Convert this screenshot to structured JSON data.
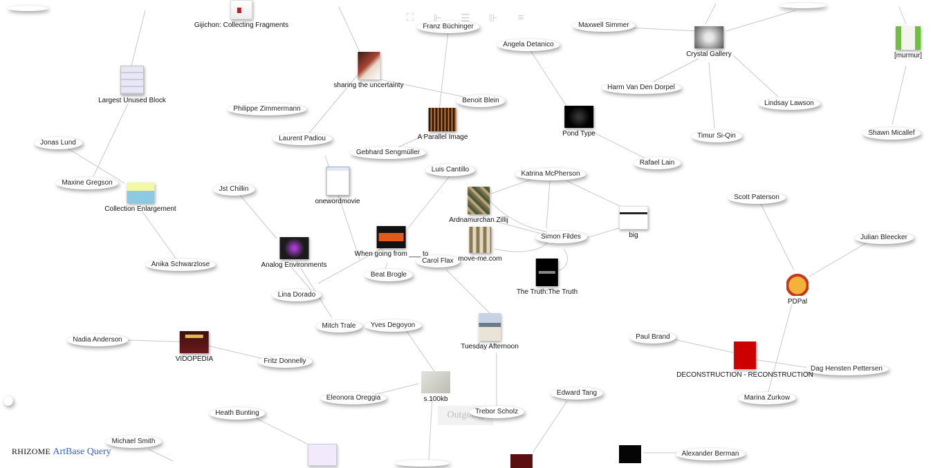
{
  "toolbar": {
    "icons": [
      "expand-icon",
      "align-left-icon",
      "align-center-icon",
      "align-right-icon",
      "list-icon"
    ]
  },
  "footer": {
    "brand": "RHIZOME",
    "query": "ArtBase Query"
  },
  "outgoing_label": "Outgoing",
  "people": [
    "Franz Büchinger",
    "Angela Detanico",
    "Maxwell Simmer",
    "Philippe Zimmermann",
    "Benoit Blein",
    "Laurent Padiou",
    "Jonas Lund",
    "Gebhard Sengmüller",
    "Harm Van Den Dorpel",
    "Lindsay Lawson",
    "Timur Si-Qin",
    "Shawn Micallef",
    "Rafael Lain",
    "Luis Cantillo",
    "Katrina McPherson",
    "Maxine Gregson",
    "Jst Chillin",
    "Scott Paterson",
    "Simon Fildes",
    "Julian Bleecker",
    "Anika Schwarzlose",
    "Carol Flax",
    "Beat Brogle",
    "Lina Dorado",
    "Mitch Trale",
    "Yves Degoyon",
    "Nadia Anderson",
    "Fritz Donnelly",
    "Paul Brand",
    "Dag Hensten Pettersen",
    "Eleonora Oreggia",
    "Marina Zurkow",
    "Edward Tang",
    "Trebor Scholz",
    "Heath Bunting",
    "Michael Smith",
    "Alexander Berman"
  ],
  "works": [
    "Gijichon: Collecting Fragments",
    "sharing the uncertainty",
    "Crystal Gallery",
    "[murmur]",
    "Largest Unused Block",
    "A Parallel Image",
    "Pond Type",
    "onewordmovie",
    "Collection Enlargement",
    "Ardnamurchan Zillij",
    "big",
    "When going from ___ to",
    "move-me.com",
    "Analog Environments",
    "The Truth:The Truth",
    "PDPal",
    "Tuesday Afternoon",
    "VIDOPEDIA",
    "DECONSTRUCTION - RECONSTRUCTION",
    "s.100kb"
  ]
}
